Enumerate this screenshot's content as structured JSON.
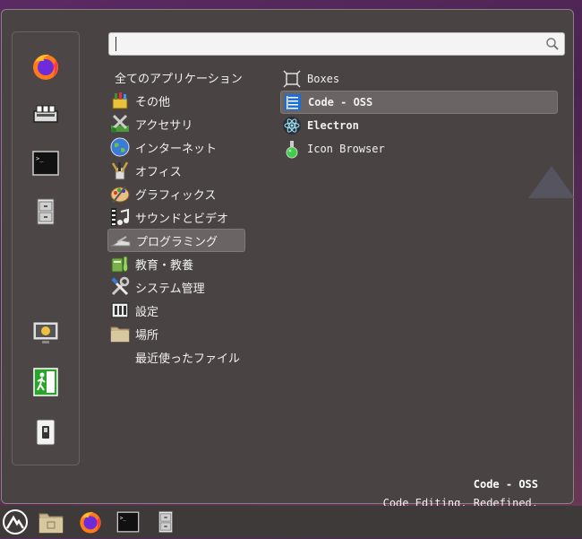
{
  "search": {
    "placeholder": ""
  },
  "favorites": [
    {
      "name": "firefox-icon"
    },
    {
      "name": "software-manager-icon"
    },
    {
      "name": "terminal-icon"
    },
    {
      "name": "file-manager-icon"
    },
    {
      "name": "screen-lock-icon"
    },
    {
      "name": "logout-icon"
    },
    {
      "name": "shutdown-icon"
    }
  ],
  "categories": [
    {
      "label": "全てのアプリケーション"
    },
    {
      "label": "その他"
    },
    {
      "label": "アクセサリ"
    },
    {
      "label": "インターネット"
    },
    {
      "label": "オフィス"
    },
    {
      "label": "グラフィックス"
    },
    {
      "label": "サウンドとビデオ"
    },
    {
      "label": "プログラミング",
      "selected": true
    },
    {
      "label": "教育・教養"
    },
    {
      "label": "システム管理"
    },
    {
      "label": "設定"
    },
    {
      "label": "場所"
    },
    {
      "label": "最近使ったファイル"
    }
  ],
  "apps": [
    {
      "label": "Boxes"
    },
    {
      "label": "Code - OSS",
      "selected": true
    },
    {
      "label": "Electron"
    },
    {
      "label": "Icon Browser"
    }
  ],
  "info": {
    "name": "Code - OSS",
    "description": "Code Editing. Redefined."
  },
  "colors": {
    "menu_bg": "#4a4343",
    "selection": "#6a6464",
    "panel_bg": "#3f3a3a"
  }
}
